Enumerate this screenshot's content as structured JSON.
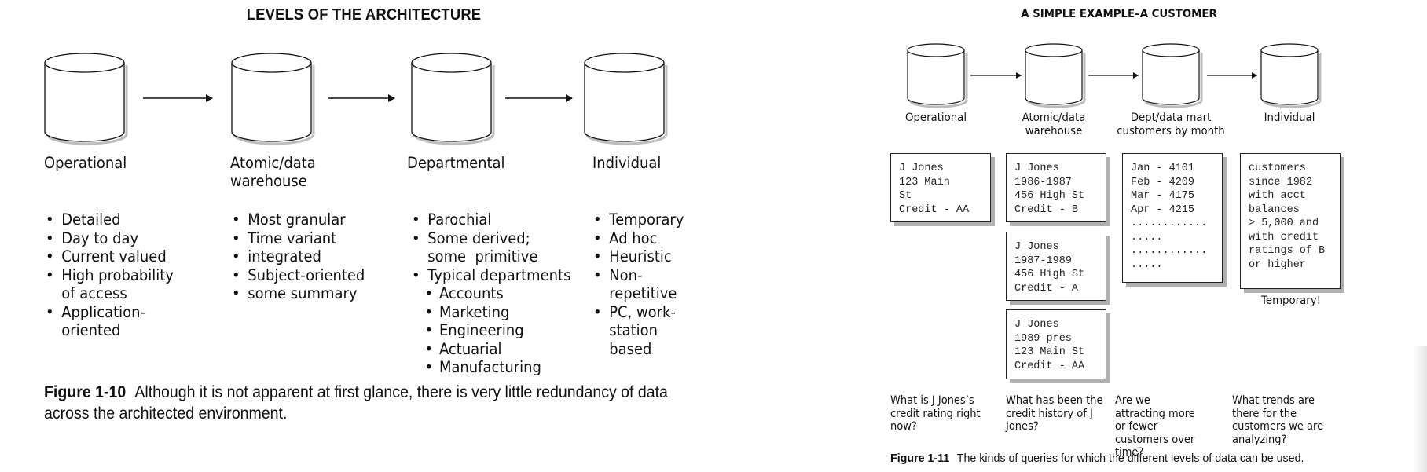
{
  "figure_1_10": {
    "title": "LEVELS OF THE ARCHITECTURE",
    "levels": [
      {
        "label": "Operational",
        "label_line2": "",
        "items": [
          {
            "text": "Detailed",
            "kind": "bullet"
          },
          {
            "text": "Day to day",
            "kind": "bullet"
          },
          {
            "text": "Current valued",
            "kind": "bullet"
          },
          {
            "text": "High probability",
            "kind": "bullet"
          },
          {
            "text": "of access",
            "kind": "cont"
          },
          {
            "text": "Application-",
            "kind": "bullet"
          },
          {
            "text": "oriented",
            "kind": "cont"
          }
        ]
      },
      {
        "label": "Atomic/data",
        "label_line2": "warehouse",
        "items": [
          {
            "text": "Most granular",
            "kind": "bullet"
          },
          {
            "text": "Time variant",
            "kind": "bullet"
          },
          {
            "text": "integrated",
            "kind": "bullet"
          },
          {
            "text": "Subject-oriented",
            "kind": "bullet"
          },
          {
            "text": "some summary",
            "kind": "bullet"
          }
        ]
      },
      {
        "label": "Departmental",
        "label_line2": "",
        "items": [
          {
            "text": "Parochial",
            "kind": "bullet"
          },
          {
            "text": "Some derived;",
            "kind": "bullet"
          },
          {
            "text": "some  primitive",
            "kind": "cont"
          },
          {
            "text": "Typical departments",
            "kind": "bullet"
          },
          {
            "text": "Accounts",
            "kind": "sub"
          },
          {
            "text": "Marketing",
            "kind": "sub"
          },
          {
            "text": "Engineering",
            "kind": "sub"
          },
          {
            "text": "Actuarial",
            "kind": "sub"
          },
          {
            "text": "Manufacturing",
            "kind": "sub"
          }
        ]
      },
      {
        "label": "Individual",
        "label_line2": "",
        "items": [
          {
            "text": "Temporary",
            "kind": "bullet"
          },
          {
            "text": "Ad hoc",
            "kind": "bullet"
          },
          {
            "text": "Heuristic",
            "kind": "bullet"
          },
          {
            "text": "Non-",
            "kind": "bullet"
          },
          {
            "text": "repetitive",
            "kind": "cont"
          },
          {
            "text": "PC, work-",
            "kind": "bullet"
          },
          {
            "text": "station",
            "kind": "cont"
          },
          {
            "text": "based",
            "kind": "cont"
          }
        ]
      }
    ],
    "caption_label": "Figure 1-10",
    "caption_text": "Although it is not apparent at first glance, there is very little redundancy of data across the architected environment."
  },
  "figure_1_11": {
    "title": "A SIMPLE EXAMPLE–A CUSTOMER",
    "levels": [
      {
        "label": "Operational",
        "label_line2": ""
      },
      {
        "label": "Atomic/data",
        "label_line2": "warehouse"
      },
      {
        "label": "Dept/data mart",
        "label_line2": "customers by month"
      },
      {
        "label": "Individual",
        "label_line2": ""
      }
    ],
    "records": {
      "operational": [
        "J Jones",
        "123 Main",
        "St",
        "Credit - AA"
      ],
      "warehouse": [
        [
          "J Jones",
          "1986-1987",
          "456 High St",
          "Credit - B"
        ],
        [
          "J Jones",
          "1987-1989",
          "456 High St",
          "Credit - A"
        ],
        [
          "J Jones",
          "1989-pres",
          "123 Main St",
          "Credit - AA"
        ]
      ],
      "data_mart": [
        "Jan - 4101",
        "Feb - 4209",
        "Mar - 4175",
        "Apr - 4215",
        "............",
        ".....",
        "............",
        "....."
      ],
      "individual": [
        "customers",
        "since 1982",
        "with acct",
        "balances",
        "> 5,000 and",
        "with credit",
        "ratings of B",
        "or higher"
      ]
    },
    "individual_note": "Temporary!",
    "queries": [
      "What is J Jones’s credit rating right now?",
      "What has been the credit history of J Jones?",
      "Are we attracting more or fewer customers over time?",
      "What trends are there for the customers we are analyzing?"
    ],
    "caption_label": "Figure 1-11",
    "caption_text": "The kinds of queries for which the different levels of data can be used."
  }
}
